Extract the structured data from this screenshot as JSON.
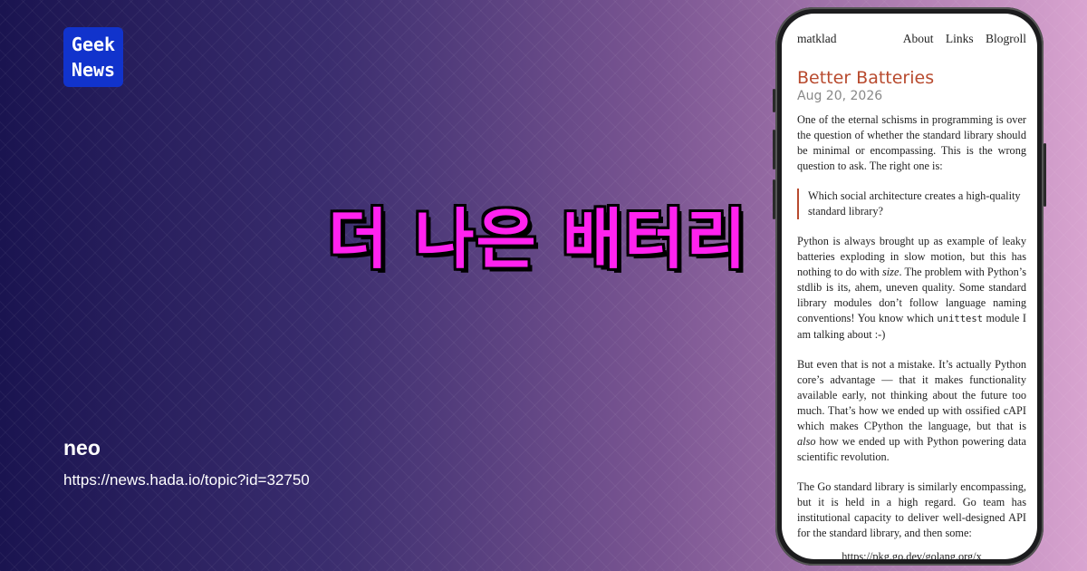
{
  "logo": {
    "line1": "Geek",
    "line2": "News"
  },
  "headline": "더 나은 배터리",
  "author": "neo",
  "url": "https://news.hada.io/topic?id=32750",
  "blog": {
    "site": "matklad",
    "nav": [
      "About",
      "Links",
      "Blogroll"
    ],
    "title": "Better Batteries",
    "date": "Aug 20, 2026",
    "p1": "One of the eternal schisms in programming is over the question of whether the standard library should be minimal or encompassing. This is the wrong question to ask. The right one is:",
    "quote": "Which social architecture creates a high-quality standard library?",
    "p2a": "Python is always brought up as example of leaky batteries exploding in slow motion, but this has nothing to do with ",
    "p2em": "size",
    "p2b": ". The problem with Python’s stdlib is its, ahem, uneven quality. Some standard library modules don’t follow language naming conventions! You know which ",
    "p2code": "unittest",
    "p2c": " module I am talking about :-)",
    "p3a": "But even that is not a mistake. It’s actually Python core’s advantage — that it makes functionality available early, not thinking about the future too much. That’s how we ended up with ossified cAPI which makes CPython the language, but that is ",
    "p3em": "also",
    "p3b": " how we ended up with Python powering data scientific revolution.",
    "p4": "The Go standard library is similarly encompassing, but it is held in a high regard. Go team has institutional capacity to deliver well-designed API for the standard library, and then some:",
    "link": "https://pkg.go.dev/golang.org/x"
  },
  "colors": {
    "headline": "#ff22ee",
    "logo_bg": "#1133cc",
    "blog_accent": "#b84a2e"
  }
}
